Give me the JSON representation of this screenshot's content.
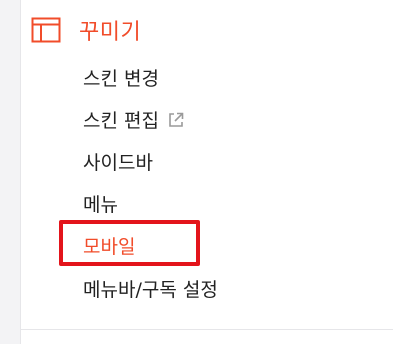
{
  "section": {
    "icon": "layout-icon",
    "title": "꾸미기",
    "accent_color": "#f14c2a"
  },
  "menu": {
    "items": [
      {
        "label": "스킨 변경"
      },
      {
        "label": "스킨 편집",
        "icon": "external-link-icon"
      },
      {
        "label": "사이드바"
      },
      {
        "label": "메뉴"
      },
      {
        "label": "모바일",
        "active": true,
        "highlighted": true
      },
      {
        "label": "메뉴바/구독 설정"
      }
    ]
  },
  "highlight_color": "#e3141b"
}
